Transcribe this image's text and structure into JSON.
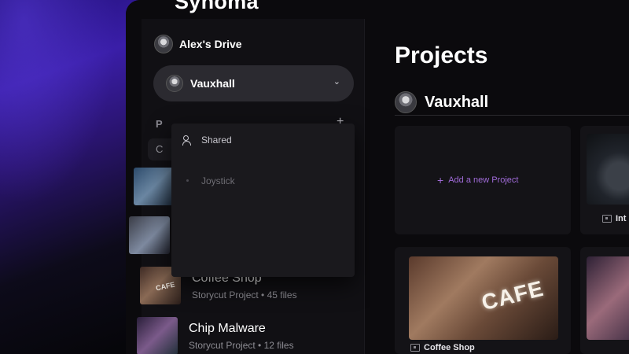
{
  "app": {
    "title": "Synoma"
  },
  "sidebar": {
    "drive_name": "Alex's Drive",
    "workspace_selected": "Vauxhall",
    "projects_heading": "P",
    "search_value": "C",
    "dropdown": {
      "items": [
        {
          "label": "Shared",
          "icon": "people-icon"
        },
        {
          "label": "Joystick",
          "icon": "dot-icon"
        }
      ]
    },
    "projects": [
      {
        "title": "",
        "subtitle": ""
      },
      {
        "title": "",
        "subtitle": ""
      },
      {
        "title": "Coffee Shop",
        "subtitle": "Storycut Project • 45 files"
      },
      {
        "title": "Chip Malware",
        "subtitle": "Storycut Project • 12 files"
      }
    ]
  },
  "main": {
    "title": "Projects",
    "workspace_name": "Vauxhall",
    "add_project_label": "Add a new Project",
    "cards": [
      {
        "title": "Int",
        "thumb_text": ""
      },
      {
        "title": "Coffee Shop",
        "thumb_text": "CAFE"
      }
    ]
  },
  "colors": {
    "accent": "#a06bd8",
    "backdrop": "#3a1ea8",
    "panel": "#111014"
  }
}
